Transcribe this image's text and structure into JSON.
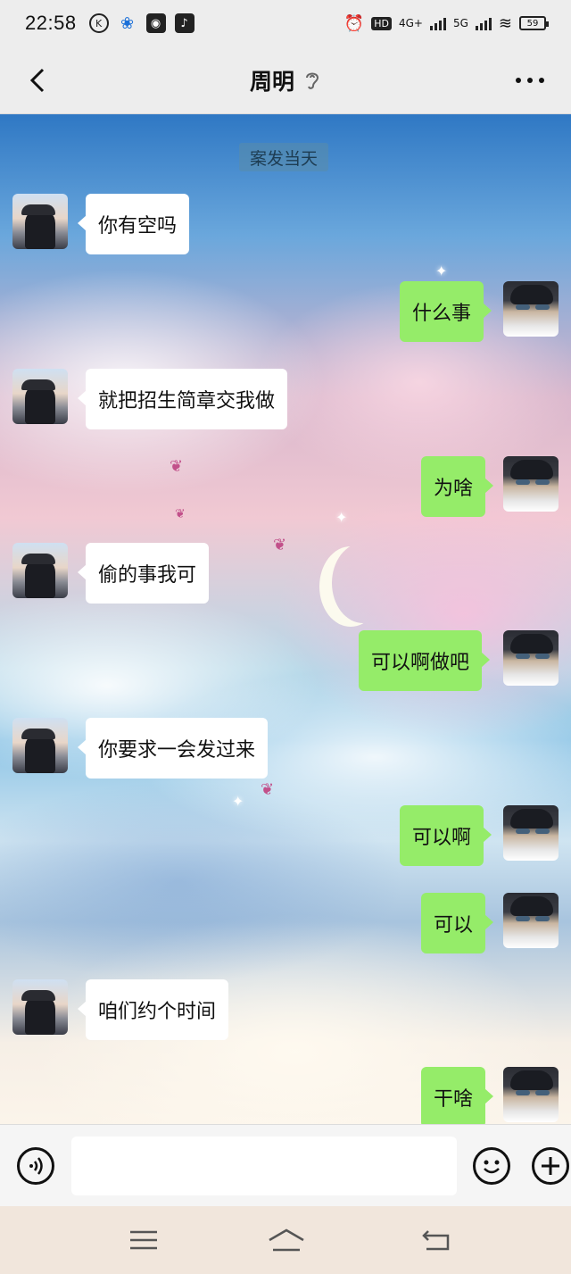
{
  "status_bar": {
    "time": "22:58",
    "network": "4G+",
    "network2": "5G",
    "hd_label": "HD",
    "battery": "59"
  },
  "header": {
    "title": "周明"
  },
  "chat": {
    "timestamp": "案发当天",
    "messages": [
      {
        "side": "in",
        "text": "你有空吗"
      },
      {
        "side": "out",
        "text": "什么事"
      },
      {
        "side": "in",
        "text": "就把招生简章交我做"
      },
      {
        "side": "out",
        "text": "为啥"
      },
      {
        "side": "in",
        "text": "偷的事我可"
      },
      {
        "side": "out",
        "text": "可以啊做吧"
      },
      {
        "side": "in",
        "text": "你要求一会发过来"
      },
      {
        "side": "out",
        "text": "可以啊"
      },
      {
        "side": "out",
        "text": "可以"
      },
      {
        "side": "in",
        "text": "咱们约个时间"
      },
      {
        "side": "out",
        "text": "干啥"
      }
    ]
  },
  "input": {
    "value": ""
  },
  "colors": {
    "outgoing_bubble": "#95ec69",
    "incoming_bubble": "#ffffff",
    "header_bg": "#ededed"
  },
  "icons": [
    "back-arrow-icon",
    "ear-icon",
    "more-icon",
    "voice-icon",
    "emoji-icon",
    "plus-icon",
    "menu-icon",
    "home-icon",
    "return-icon"
  ]
}
